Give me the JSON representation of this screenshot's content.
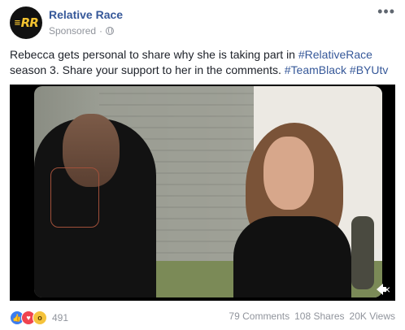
{
  "page": {
    "name": "Relative Race",
    "avatar_text": "RR",
    "sponsored": "Sponsored",
    "separator": "·",
    "more": "•••"
  },
  "post": {
    "text_part1": "Rebecca gets personal to share why she is taking part in ",
    "hashtag1": "#RelativeRace",
    "text_part2": " season 3. Share your support to her in the comments. ",
    "hashtag2": "#TeamBlack",
    "text_space": " ",
    "hashtag3": "#BYUtv"
  },
  "video": {
    "mute_symbol": "×"
  },
  "footer": {
    "reaction_count": "491",
    "comments": "79 Comments",
    "shares": "108 Shares",
    "views": "20K Views"
  },
  "colors": {
    "link": "#365899",
    "meta": "#90949c",
    "like": "#3b7df0",
    "love": "#f0434f",
    "wow": "#f5c33b"
  }
}
